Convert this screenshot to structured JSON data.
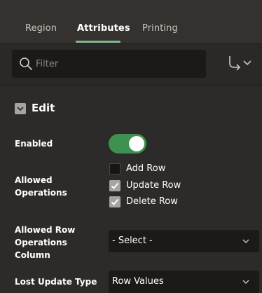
{
  "tabs": [
    {
      "label": "Region",
      "active": false
    },
    {
      "label": "Attributes",
      "active": true
    },
    {
      "label": "Printing",
      "active": false
    }
  ],
  "toolbar": {
    "search_placeholder": "Filter",
    "search_value": "",
    "go_icon": "go-to-group-icon"
  },
  "section": {
    "title": "Edit",
    "icon": "collapse-icon"
  },
  "fields": {
    "enabled": {
      "label": "Enabled",
      "value": "on"
    },
    "allowed_operations": {
      "label": "Allowed Operations",
      "options": [
        {
          "label": "Add Row",
          "checked": false
        },
        {
          "label": "Update Row",
          "checked": true
        },
        {
          "label": "Delete Row",
          "checked": true
        }
      ]
    },
    "allowed_row_operations_column": {
      "label": "Allowed Row Operations Column",
      "value": "- Select -"
    },
    "lost_update_type": {
      "label": "Lost Update Type",
      "value": "Row Values"
    }
  },
  "colors": {
    "accent": "#7fb88c",
    "toggle_on": "#3f9151",
    "background": "#2d2b29"
  }
}
